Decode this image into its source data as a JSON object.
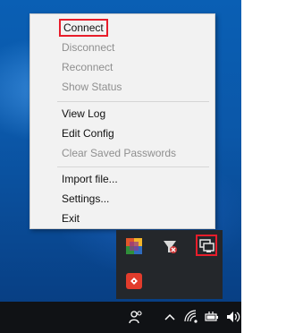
{
  "menu": {
    "items": [
      {
        "label": "Connect",
        "enabled": true,
        "highlighted": true
      },
      {
        "label": "Disconnect",
        "enabled": false
      },
      {
        "label": "Reconnect",
        "enabled": false
      },
      {
        "label": "Show Status",
        "enabled": false
      },
      {
        "label": "View Log",
        "enabled": true
      },
      {
        "label": "Edit Config",
        "enabled": true
      },
      {
        "label": "Clear Saved Passwords",
        "enabled": false
      },
      {
        "label": "Import file...",
        "enabled": true
      },
      {
        "label": "Settings...",
        "enabled": true
      },
      {
        "label": "Exit",
        "enabled": true
      }
    ]
  },
  "tray_overflow": {
    "icons": [
      {
        "name": "colorful-app-icon"
      },
      {
        "name": "bandwidth-monitor-icon"
      },
      {
        "name": "openvpn-gui-icon",
        "highlighted": true
      },
      {
        "name": "red-app-icon"
      }
    ]
  },
  "taskbar": {
    "icons": [
      {
        "name": "people-icon"
      },
      {
        "name": "show-hidden-icons-chevron"
      },
      {
        "name": "wifi-icon"
      },
      {
        "name": "battery-icon"
      },
      {
        "name": "volume-icon"
      }
    ]
  },
  "colors": {
    "highlight_border": "#e81d2b",
    "menu_background": "#f2f2f2",
    "disabled_text": "#8f8f8f",
    "tray_background": "#24272b",
    "taskbar_background": "#101215"
  }
}
